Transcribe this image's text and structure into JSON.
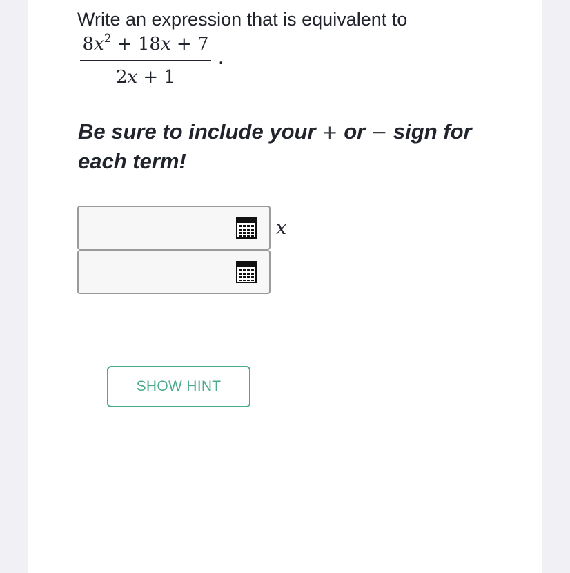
{
  "question": {
    "prompt": "Write an expression that is equivalent to",
    "numerator": {
      "coef": "8",
      "var": "x",
      "exp": "2",
      "rest_op1": " + 18",
      "rest_var": "x",
      "rest_op2": " + 7"
    },
    "denominator": {
      "coef": "2",
      "var": "x",
      "rest": " + 1"
    },
    "period": "."
  },
  "instruction": {
    "part1": "Be sure to include your ",
    "plus_sign": "+",
    "part2": " or ",
    "minus_sign": "−",
    "part3": " sign for each term!"
  },
  "answers": {
    "first": {
      "value": "",
      "trailing_var": "x"
    },
    "second": {
      "value": ""
    }
  },
  "icons": {
    "calculator": "calculator-icon"
  },
  "hint": {
    "label": "SHOW HINT"
  },
  "colors": {
    "accent": "#4aaa8c",
    "text": "#21242c",
    "background": "#f0f0f5",
    "input_border": "#9a9a9a"
  }
}
